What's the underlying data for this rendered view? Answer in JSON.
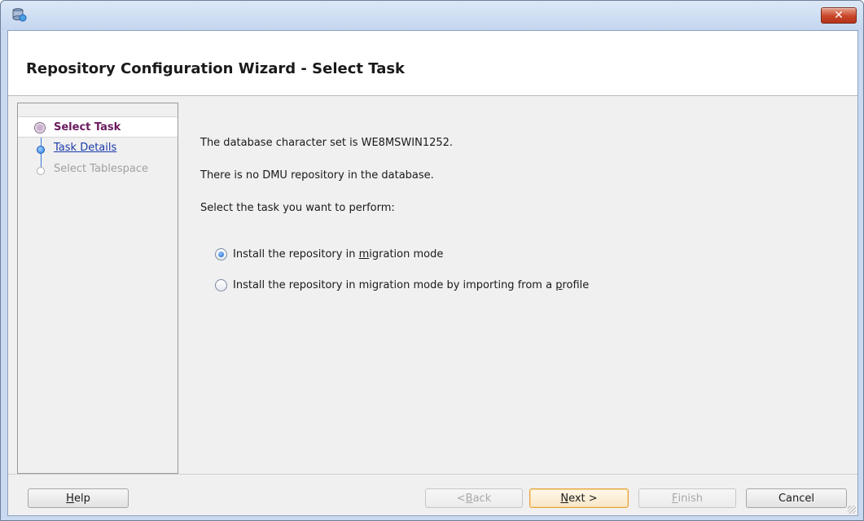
{
  "window": {
    "title": "Repository Configuration Wizard - Select Task",
    "close_glyph": "✕"
  },
  "nav": {
    "items": [
      {
        "label": "Select Task",
        "state": "active"
      },
      {
        "label": "Task Details",
        "state": "link"
      },
      {
        "label": "Select Tablespace",
        "state": "disabled"
      }
    ]
  },
  "content": {
    "charset_text": "The database character set is WE8MSWIN1252.",
    "repo_text": "There is no DMU repository in the database.",
    "prompt_text": "Select the task you want to perform:",
    "option1": {
      "pre": "Install the repository in ",
      "mnemonic": "m",
      "post": "igration mode",
      "checked": true
    },
    "option2": {
      "pre": "Install the repository in migration mode by importing from a ",
      "mnemonic": "p",
      "post": "rofile",
      "checked": false
    }
  },
  "buttons": {
    "help": {
      "mnemonic": "H",
      "rest": "elp"
    },
    "back": {
      "pre": "< ",
      "mnemonic": "B",
      "rest": "ack"
    },
    "next": {
      "mnemonic": "N",
      "rest": "ext >"
    },
    "finish": {
      "mnemonic": "F",
      "rest": "inish"
    },
    "cancel": "Cancel"
  },
  "colors": {
    "active_step": "#6a1b5e",
    "link_step": "#1a3aa8",
    "default_button_border": "#e8a23a"
  }
}
